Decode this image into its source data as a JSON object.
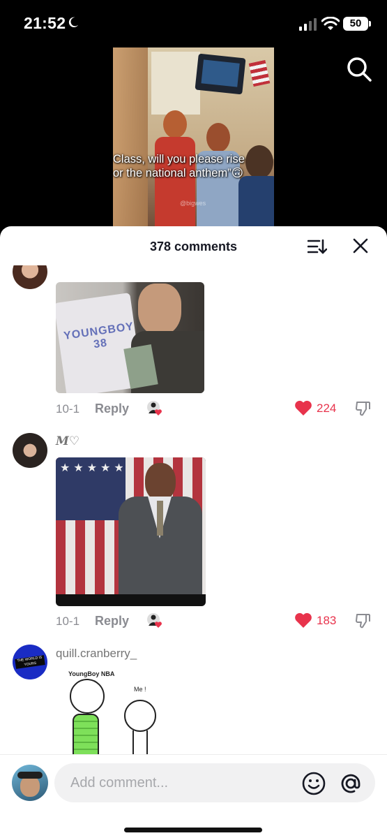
{
  "status_bar": {
    "time": "21:52",
    "battery": "50",
    "icons": [
      "moon-icon",
      "signal-icon",
      "wifi-icon",
      "battery-icon"
    ]
  },
  "video": {
    "caption_line1": "Class, will you please rise",
    "caption_line2": "or the national anthem”🙃",
    "watermark": "@bigwes"
  },
  "header": {
    "count_label": "378 comments",
    "icons": [
      "sort-icon",
      "close-icon"
    ]
  },
  "comments": [
    {
      "username": "",
      "image_text": "YOUNGBOY 38",
      "date": "10-1",
      "reply": "Reply",
      "likes": "224"
    },
    {
      "username": "M♡",
      "date": "10-1",
      "reply": "Reply",
      "likes": "183"
    },
    {
      "username": "quill.cranberry_",
      "avatar_text": "THE WORLD IS YOURS",
      "image_caption": "YoungBoy NBA",
      "image_caption2": "Me !"
    }
  ],
  "composer": {
    "placeholder": "Add comment...",
    "icons": [
      "emoji-icon",
      "mention-icon"
    ]
  },
  "colors": {
    "accent_like": "#e8334c",
    "sheet_bg": "#ffffff",
    "meta_gray": "#8a8b91"
  }
}
